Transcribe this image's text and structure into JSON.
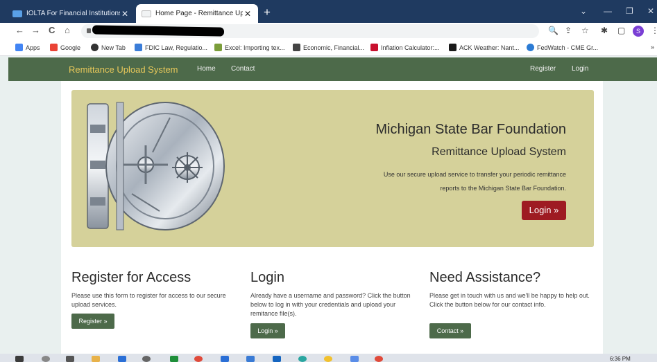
{
  "browser": {
    "tabs": [
      {
        "label": "IOLTA For Financial Institutions -"
      },
      {
        "label": "Home Page - Remittance Upload"
      }
    ],
    "new_tab_icon": "+",
    "window_controls": [
      "⌄",
      "—",
      "❐",
      "✕"
    ],
    "nav_icons": [
      "←",
      "→",
      "C",
      "⌂"
    ],
    "toolbar_icons": [
      "🔍",
      "⇪",
      "☆",
      "✱",
      "▢",
      "⋮"
    ],
    "profile_initial": "S"
  },
  "bookmarks": [
    {
      "label": "Apps",
      "color": "#4285f4"
    },
    {
      "label": "Google",
      "color": "#ea4335"
    },
    {
      "label": "New Tab",
      "color": "#333333"
    },
    {
      "label": "FDIC Law, Regulatio...",
      "color": "#3b7dd8"
    },
    {
      "label": "Excel: Importing tex...",
      "color": "#7b9d3a"
    },
    {
      "label": "Economic, Financial...",
      "color": "#444444"
    },
    {
      "label": "Inflation Calculator:...",
      "color": "#c8102e"
    },
    {
      "label": "ACK Weather: Nant...",
      "color": "#1a1a1a"
    },
    {
      "label": "FedWatch - CME Gr...",
      "color": "#2b7bd4"
    }
  ],
  "site": {
    "brand": "Remittance Upload System",
    "nav": {
      "home": "Home",
      "contact": "Contact",
      "register": "Register",
      "login": "Login"
    },
    "jumbotron": {
      "title": "Michigan State Bar Foundation",
      "subtitle": "Remittance Upload System",
      "line1": "Use our secure upload service to transfer your periodic remittance",
      "line2": "reports to the Michigan State Bar Foundation.",
      "button": "Login »"
    },
    "columns": [
      {
        "heading": "Register for Access",
        "text": "Please use this form to register for access to our secure upload services.",
        "button": "Register »"
      },
      {
        "heading": "Login",
        "text": "Already have a username and password? Click the button below to log in with your credentials and upload your remitance file(s).",
        "button": "Login »"
      },
      {
        "heading": "Need Assistance?",
        "text": "Please get in touch with us and we'll be happy to help out. Click the button below for our contact info.",
        "button": "Contact »"
      }
    ]
  },
  "taskbar": {
    "time": "6:36 PM"
  },
  "colors": {
    "navbar": "#4d6a4a",
    "brand": "#e8c85a",
    "jumbotron": "#d5d19a",
    "primary_button": "#9e1b22"
  }
}
